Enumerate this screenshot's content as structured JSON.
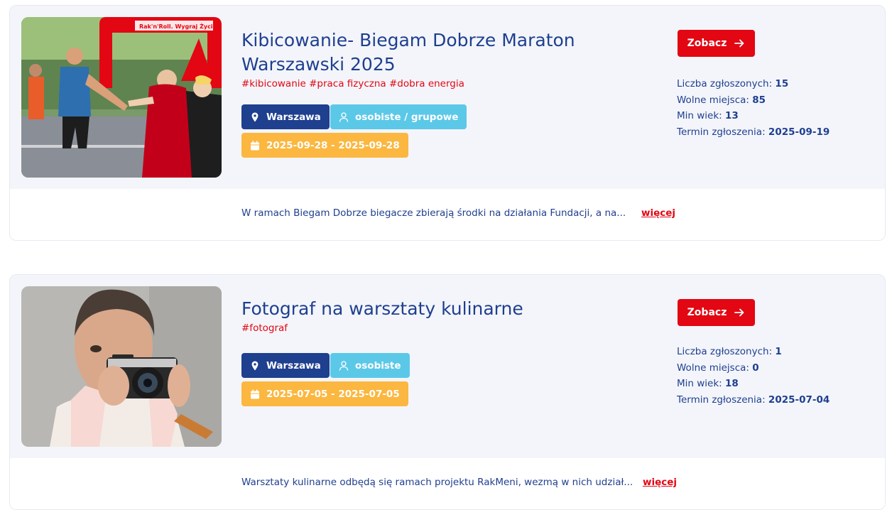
{
  "colors": {
    "brand_blue": "#1f3f8f",
    "accent_red": "#e30613",
    "type_badge": "#5bc8e8",
    "date_badge": "#fbb740",
    "card_bg": "#f3f5fa"
  },
  "cards": [
    {
      "title": "Kibicowanie- Biegam Dobrze Maraton Warszawski 2025",
      "tags": "#kibicowanie #praca fizyczna #dobra energia",
      "location": "Warszawa",
      "location_icon": "map-pin-icon",
      "type": "osobiste / grupowe",
      "type_icon": "person-icon",
      "dates": "2025-09-28 - 2025-09-28",
      "date_icon": "calendar-icon",
      "button_label": "Zobacz",
      "button_icon": "arrow-right-icon",
      "stats": {
        "registered_label": "Liczba zgłoszonych:",
        "registered_value": "15",
        "free_label": "Wolne miejsca:",
        "free_value": "85",
        "min_age_label": "Min wiek:",
        "min_age_value": "13",
        "deadline_label": "Termin zgłoszenia:",
        "deadline_value": "2025-09-19"
      },
      "description": "W ramach Biegam Dobrze biegacze zbierają środki na działania Fundacji, a na...",
      "more_label": "więcej",
      "image_banner_text": "Rak'n'Roll. Wygraj Życie!"
    },
    {
      "title": "Fotograf na warsztaty kulinarne",
      "tags": "#fotograf",
      "location": "Warszawa",
      "location_icon": "map-pin-icon",
      "type": "osobiste",
      "type_icon": "person-icon",
      "dates": "2025-07-05 - 2025-07-05",
      "date_icon": "calendar-icon",
      "button_label": "Zobacz",
      "button_icon": "arrow-right-icon",
      "stats": {
        "registered_label": "Liczba zgłoszonych:",
        "registered_value": "1",
        "free_label": "Wolne miejsca:",
        "free_value": "0",
        "min_age_label": "Min wiek:",
        "min_age_value": "18",
        "deadline_label": "Termin zgłoszenia:",
        "deadline_value": "2025-07-04"
      },
      "description": "Warsztaty kulinarne odbędą się ramach projektu RakMeni, wezmą w nich udział...",
      "more_label": "więcej"
    }
  ]
}
